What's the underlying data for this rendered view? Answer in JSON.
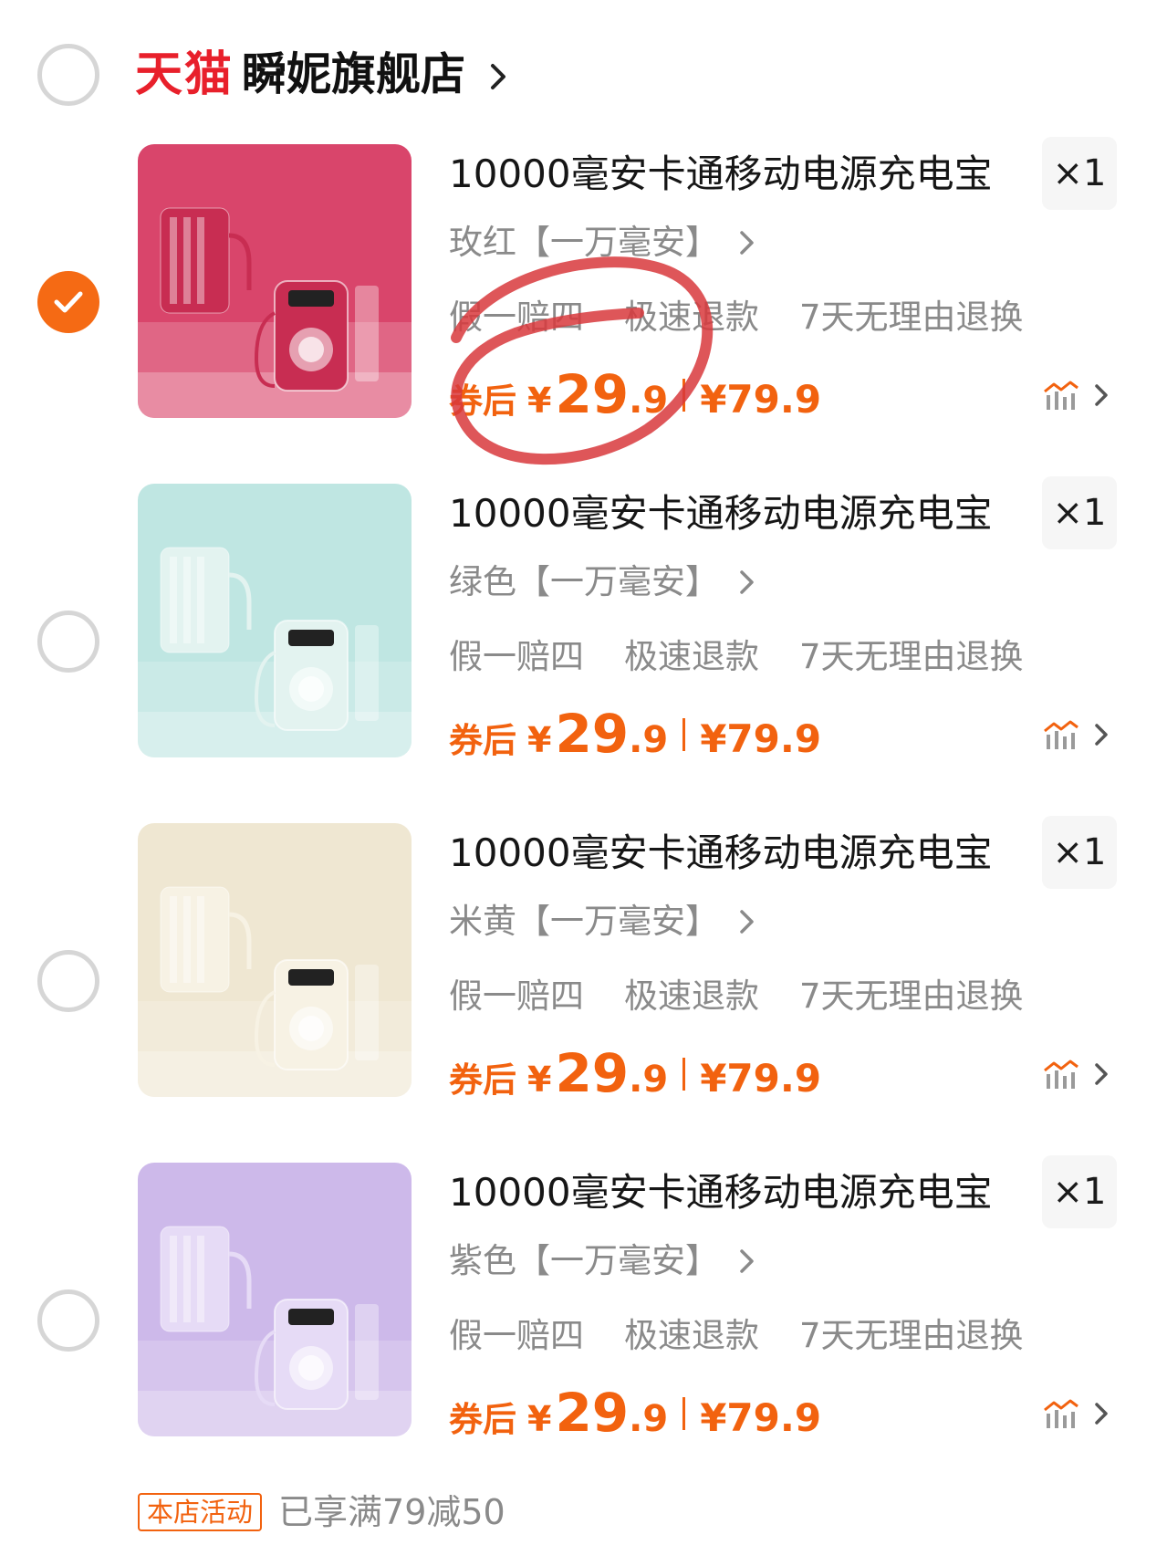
{
  "store": {
    "platform_logo": "天猫",
    "name": "瞬妮旗舰店",
    "radio_checked": false
  },
  "items": [
    {
      "title": "10000毫安卡通移动电源充电宝",
      "quantity": "×1",
      "variant": "玫红【一万毫安】",
      "tags": [
        "假一赔四",
        "极速退款",
        "7天无理由退换"
      ],
      "price_label": "券后",
      "yen": "¥",
      "price_int": "29",
      "price_dec": ".9",
      "original_price": "¥79.9",
      "checked": true,
      "thumb_color": "#d9456b",
      "device_color": "#c82d52"
    },
    {
      "title": "10000毫安卡通移动电源充电宝",
      "quantity": "×1",
      "variant": "绿色【一万毫安】",
      "tags": [
        "假一赔四",
        "极速退款",
        "7天无理由退换"
      ],
      "price_label": "券后",
      "yen": "¥",
      "price_int": "29",
      "price_dec": ".9",
      "original_price": "¥79.9",
      "checked": false,
      "thumb_color": "#bfe6e2",
      "device_color": "#e3f3f0"
    },
    {
      "title": "10000毫安卡通移动电源充电宝",
      "quantity": "×1",
      "variant": "米黄【一万毫安】",
      "tags": [
        "假一赔四",
        "极速退款",
        "7天无理由退换"
      ],
      "price_label": "券后",
      "yen": "¥",
      "price_int": "29",
      "price_dec": ".9",
      "original_price": "¥79.9",
      "checked": false,
      "thumb_color": "#efe7d2",
      "device_color": "#f7f2e4"
    },
    {
      "title": "10000毫安卡通移动电源充电宝",
      "quantity": "×1",
      "variant": "紫色【一万毫安】",
      "tags": [
        "假一赔四",
        "极速退款",
        "7天无理由退换"
      ],
      "price_label": "券后",
      "yen": "¥",
      "price_int": "29",
      "price_dec": ".9",
      "original_price": "¥79.9",
      "checked": false,
      "thumb_color": "#cdb9ea",
      "device_color": "#e6dbf6"
    }
  ],
  "promo": {
    "tag": "本店活动",
    "text": "已享满79减50"
  },
  "colors": {
    "accent_orange": "#f2620f",
    "tmall_red": "#e8202b",
    "annotation_red": "#d8383c"
  }
}
